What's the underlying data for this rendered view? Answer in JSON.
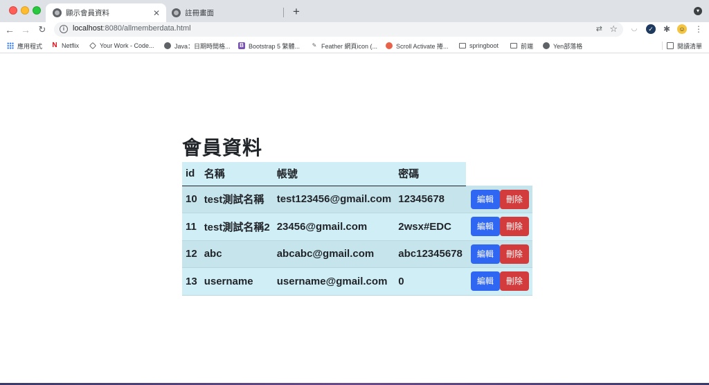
{
  "browser": {
    "tabs": [
      {
        "title": "顯示會員資料",
        "active": true
      },
      {
        "title": "註冊畫面",
        "active": false
      }
    ],
    "new_tab_label": "+",
    "url_host": "localhost",
    "url_rest": ":8080/allmemberdata.html",
    "bookmarks": [
      {
        "label": "應用程式",
        "icon": "apps-grid-icon"
      },
      {
        "label": "Netflix",
        "icon": "netflix-icon"
      },
      {
        "label": "Your Work - Code...",
        "icon": "codepen-icon"
      },
      {
        "label": "Java：日期時間格...",
        "icon": "globe-icon"
      },
      {
        "label": "Bootstrap 5 繁體...",
        "icon": "bootstrap-icon"
      },
      {
        "label": "Feather 網頁icon (...",
        "icon": "feather-icon"
      },
      {
        "label": "Scroll Activate 捲...",
        "icon": "scroll-icon"
      },
      {
        "label": "springboot",
        "icon": "folder-icon"
      },
      {
        "label": "前端",
        "icon": "folder-icon"
      },
      {
        "label": "Yen部落格",
        "icon": "globe-icon"
      }
    ],
    "reading_list_label": "閱讀清單"
  },
  "page": {
    "title": "會員資料",
    "columns": [
      "id",
      "名稱",
      "帳號",
      "密碼"
    ],
    "edit_label": "編輯",
    "delete_label": "刪除",
    "rows": [
      {
        "id": "10",
        "name": "test測試名稱",
        "account": "test123456@gmail.com",
        "password": "12345678"
      },
      {
        "id": "11",
        "name": "test測試名稱2",
        "account": "23456@gmail.com",
        "password": "2wsx#EDC"
      },
      {
        "id": "12",
        "name": "abc",
        "account": "abcabc@gmail.com",
        "password": "abc12345678"
      },
      {
        "id": "13",
        "name": "username",
        "account": "username@gmail.com",
        "password": "0"
      }
    ]
  },
  "colors": {
    "header_bg": "#cfeef6",
    "row_dark": "#c5e4ec",
    "row_light": "#d0eef6",
    "edit_button": "#2f66f2",
    "delete_button": "#d23c3c"
  }
}
